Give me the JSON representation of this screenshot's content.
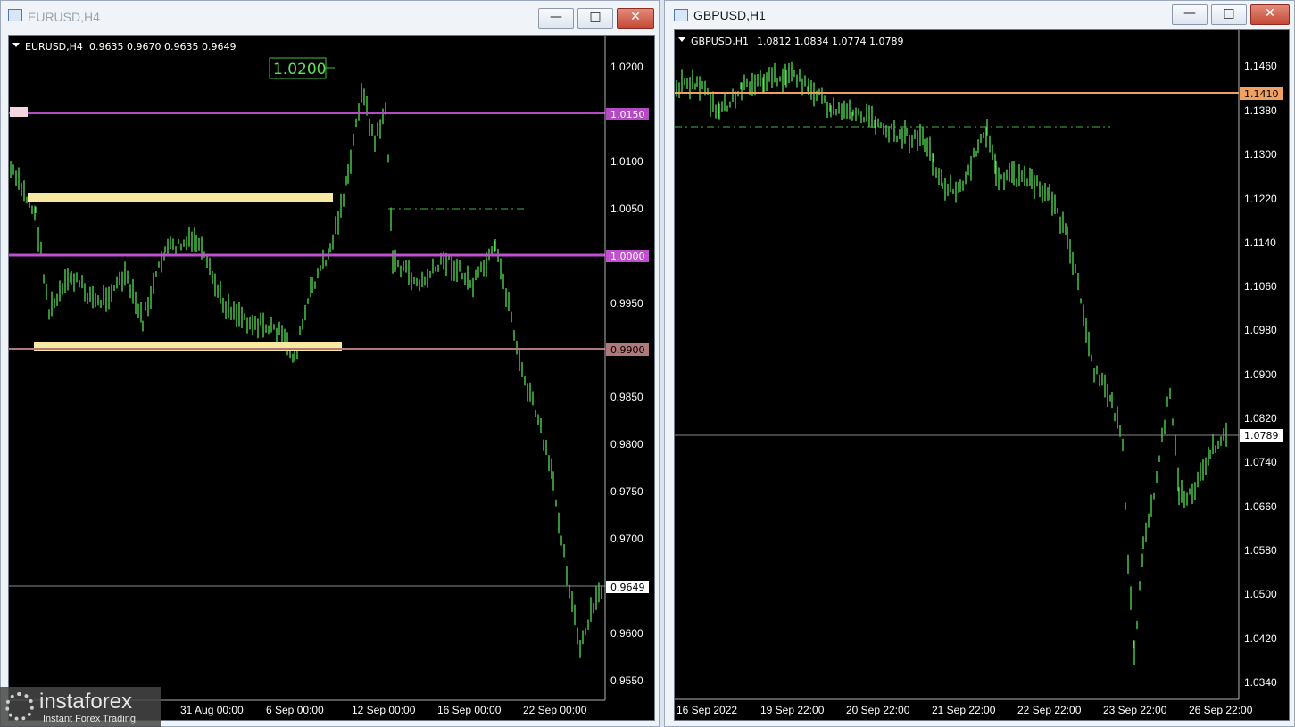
{
  "left": {
    "title": "EURUSD,H4",
    "buttons": {
      "minimize": "—",
      "restore": "□",
      "close": "✕"
    },
    "info": {
      "symbol": "EURUSD,H4",
      "ohlc": "0.9635 0.9670 0.9635 0.9649"
    },
    "annotation": "1.0200",
    "price_axis": [
      "1.0200",
      "1.0150",
      "1.0100",
      "1.0050",
      "1.0000",
      "0.9950",
      "0.9900",
      "0.9850",
      "0.9800",
      "0.9750",
      "0.9700",
      "0.9649",
      "0.9600",
      "0.9550"
    ],
    "time_axis": [
      "31 Aug 00:00",
      "6 Sep 00:00",
      "12 Sep 00:00",
      "16 Sep 00:00",
      "22 Sep 00:00"
    ],
    "level_labels": {
      "upper": "1.0150",
      "mid": "1.0000",
      "lower": "0.9900",
      "current": "0.9649"
    },
    "colors": {
      "candle": "#55e055",
      "upper_line": "#b44bc4",
      "mid_line": "#c050d0",
      "lower_line": "#b07878",
      "zone": "#f7e9a0",
      "grid": "#1a1a1a"
    }
  },
  "right": {
    "title": "GBPUSD,H1",
    "buttons": {
      "minimize": "—",
      "restore": "□",
      "close": "✕"
    },
    "info": {
      "symbol": "GBPUSD,H1",
      "ohlc": "1.0812 1.0834 1.0774 1.0789"
    },
    "price_axis": [
      "1.1460",
      "1.1380",
      "1.1300",
      "1.1220",
      "1.1140",
      "1.1060",
      "1.0980",
      "1.0900",
      "1.0820",
      "1.0740",
      "1.0660",
      "1.0580",
      "1.0500",
      "1.0420",
      "1.0340"
    ],
    "time_axis": [
      "16 Sep 2022",
      "19 Sep 22:00",
      "20 Sep 22:00",
      "21 Sep 22:00",
      "22 Sep 22:00",
      "23 Sep 22:00",
      "26 Sep 22:00"
    ],
    "level_labels": {
      "resistance": "1.1410",
      "current": "1.0789"
    },
    "colors": {
      "candle": "#55e055",
      "resistance_line": "#f0a060"
    }
  },
  "watermark": {
    "brand": "instaforex",
    "tagline": "Instant Forex Trading"
  }
}
